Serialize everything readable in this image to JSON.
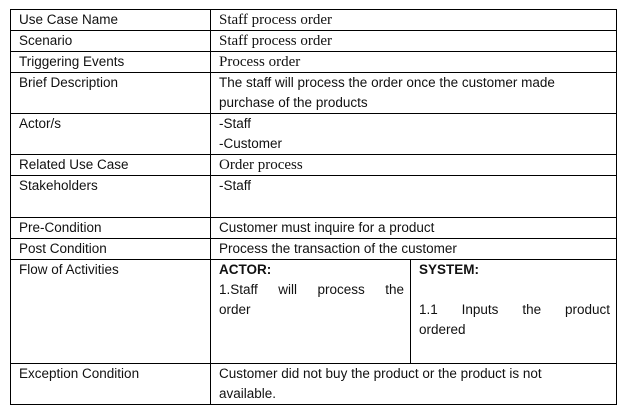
{
  "rows": {
    "use_case_name": {
      "label": "Use Case Name",
      "value": "Staff process order"
    },
    "scenario": {
      "label": "Scenario",
      "value": "Staff process order"
    },
    "triggering_events": {
      "label": "Triggering Events",
      "value": "Process order"
    },
    "brief_description": {
      "label": "Brief Description",
      "value_line1": "The staff will process the order once the customer made",
      "value_line2": "purchase of the products"
    },
    "actors": {
      "label": "Actor/s",
      "value_line1": "-Staff",
      "value_line2": "-Customer"
    },
    "related_use_case": {
      "label": "Related Use Case",
      "value": "Order process"
    },
    "stakeholders": {
      "label": "Stakeholders",
      "value": "-Staff"
    },
    "pre_condition": {
      "label": "Pre-Condition",
      "value": "Customer must inquire for a product"
    },
    "post_condition": {
      "label": "Post Condition",
      "value": "Process the transaction of the customer"
    },
    "flow_of_activities": {
      "label": "Flow of Activities",
      "actor_header": "ACTOR:",
      "actor_line1": "1.Staff will process the",
      "actor_line2": "order",
      "system_header": "SYSTEM:",
      "system_line1": "1.1 Inputs the product",
      "system_line2": "ordered"
    },
    "exception_condition": {
      "label": "Exception Condition",
      "value_line1": "Customer did not buy the product or the product is not",
      "value_line2": "available."
    }
  }
}
